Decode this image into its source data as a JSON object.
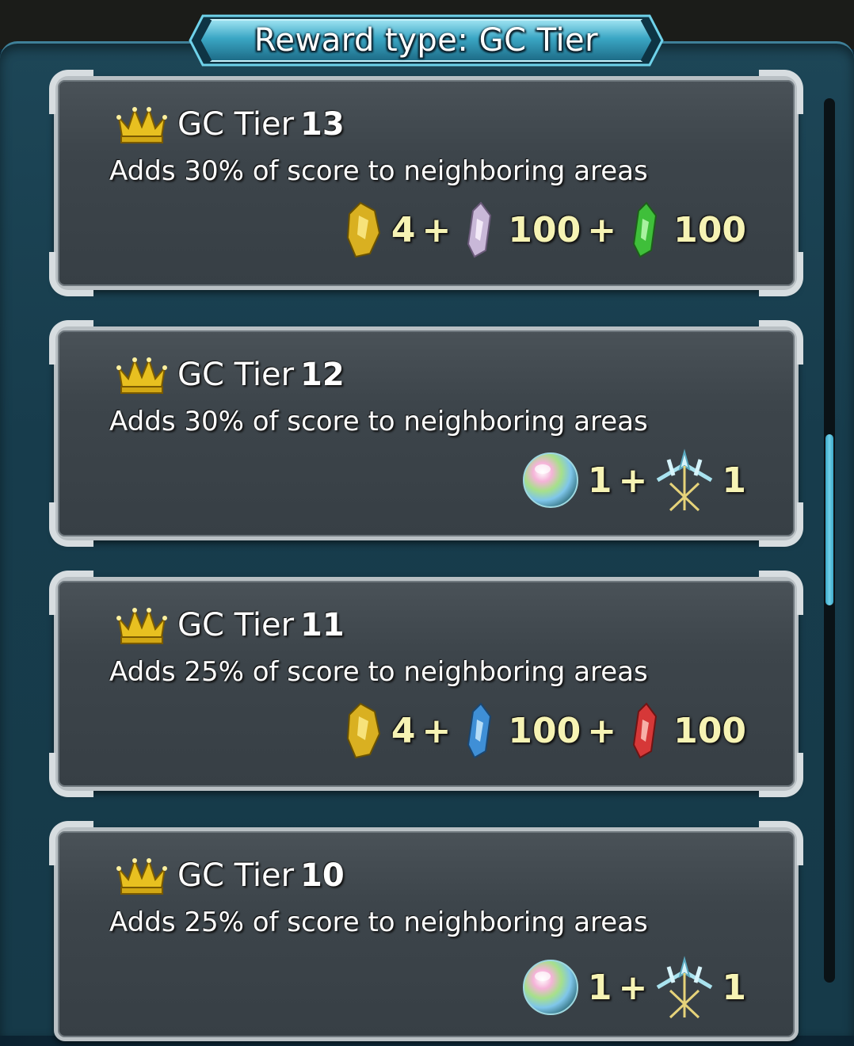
{
  "header": {
    "title": "Reward type: GC Tier"
  },
  "tiers": [
    {
      "label": "GC Tier",
      "number": "13",
      "description": "Adds 30% of score to neighboring areas",
      "rewards": [
        {
          "icon": "gold-dew-icon",
          "value": "4",
          "sep": "+"
        },
        {
          "icon": "universal-shard-icon",
          "value": "100",
          "sep": "+"
        },
        {
          "icon": "green-shard-icon",
          "value": "100",
          "sep": ""
        }
      ]
    },
    {
      "label": "GC Tier",
      "number": "12",
      "description": "Adds 30% of score to neighboring areas",
      "rewards": [
        {
          "icon": "rainbow-orb-icon",
          "value": "1",
          "sep": "+"
        },
        {
          "icon": "trident-badge-icon",
          "value": "1",
          "sep": ""
        }
      ]
    },
    {
      "label": "GC Tier",
      "number": "11",
      "description": "Adds 25% of score to neighboring areas",
      "rewards": [
        {
          "icon": "gold-dew-icon",
          "value": "4",
          "sep": "+"
        },
        {
          "icon": "blue-shard-icon",
          "value": "100",
          "sep": "+"
        },
        {
          "icon": "red-shard-icon",
          "value": "100",
          "sep": ""
        }
      ]
    },
    {
      "label": "GC Tier",
      "number": "10",
      "description": "Adds 25% of score to neighboring areas",
      "rewards": [
        {
          "icon": "rainbow-orb-icon",
          "value": "1",
          "sep": "+"
        },
        {
          "icon": "trident-badge-icon",
          "value": "1",
          "sep": ""
        }
      ]
    }
  ],
  "colors": {
    "gold": "#e8c020",
    "value_text": "#f6f3b4",
    "shard_universal": "#c9b8d8",
    "shard_green": "#3fbf3a",
    "shard_blue": "#3f8fd6",
    "shard_red": "#d63838",
    "scroll_accent": "#4fbcd8"
  }
}
